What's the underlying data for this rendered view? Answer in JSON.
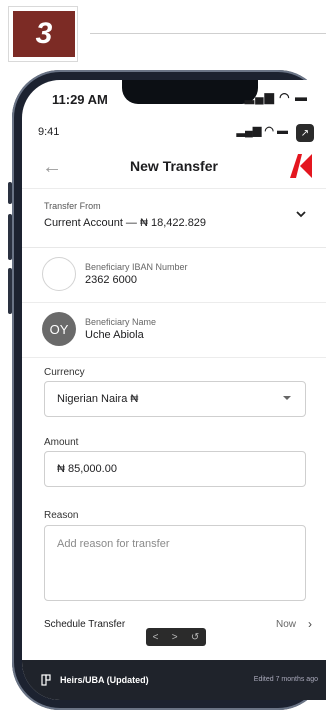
{
  "step": {
    "number": "3"
  },
  "status_outer": {
    "time": "11:29 AM",
    "icons": "▂▄▆ ◠ ▬"
  },
  "status_inner": {
    "time": "9:41",
    "icons": "▂▄▆ ◠ ▬",
    "expand_icon": "↗"
  },
  "header": {
    "back_icon": "←",
    "title": "New Transfer"
  },
  "transfer_from": {
    "label": "Transfer From",
    "value": "Current Account — ₦ 18,422.829"
  },
  "beneficiary_iban": {
    "label": "Beneficiary IBAN Number",
    "value": "2362 6000"
  },
  "beneficiary_name": {
    "label": "Beneficiary Name",
    "value": "Uche Abiola",
    "initials": "OY"
  },
  "currency": {
    "label": "Currency",
    "value": "Nigerian Naira ₦"
  },
  "amount": {
    "label": "Amount",
    "value": "₦ 85,000.00"
  },
  "reason": {
    "label": "Reason",
    "placeholder": "Add reason for transfer"
  },
  "schedule": {
    "label": "Schedule Transfer",
    "value": "Now",
    "arrow": "›"
  },
  "nav": {
    "prev": "<",
    "next": ">",
    "refresh": "↺"
  },
  "bottom": {
    "title": "Heirs/UBA (Updated)",
    "edited": "Edited 7 months ago"
  },
  "colors": {
    "brand": "#e4161f",
    "badge": "#7c2b25"
  }
}
